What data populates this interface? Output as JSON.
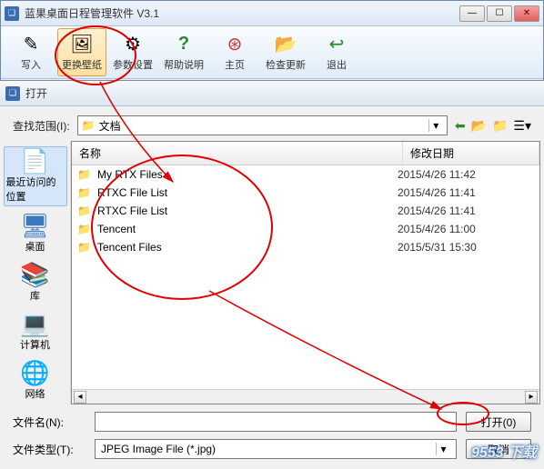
{
  "app": {
    "title": "蓝果桌面日程管理软件 V3.1",
    "toolbar": [
      {
        "label": "写入",
        "icon": "✎"
      },
      {
        "label": "更换壁纸",
        "icon": "🖼",
        "active": true
      },
      {
        "label": "参数设置",
        "icon": "⚙"
      },
      {
        "label": "帮助说明",
        "icon": "?"
      },
      {
        "label": "主页",
        "icon": "⊛"
      },
      {
        "label": "检查更新",
        "icon": "📂"
      },
      {
        "label": "退出",
        "icon": "↩"
      }
    ]
  },
  "dialog": {
    "title": "打开",
    "lookin_label": "查找范围(I):",
    "lookin_value": "文档",
    "nav_icons": [
      "arrow-left",
      "up-folder",
      "new-folder",
      "views"
    ],
    "places": [
      {
        "label": "最近访问的位置",
        "icon": "📄",
        "selected": true
      },
      {
        "label": "桌面",
        "icon": "🖥"
      },
      {
        "label": "库",
        "icon": "📚"
      },
      {
        "label": "计算机",
        "icon": "💻"
      },
      {
        "label": "网络",
        "icon": "🌐"
      }
    ],
    "columns": {
      "name": "名称",
      "date": "修改日期"
    },
    "files": [
      {
        "name": "My RTX Files",
        "date": "2015/4/26 11:42"
      },
      {
        "name": "RTXC File List",
        "date": "2015/4/26 11:41"
      },
      {
        "name": "RTXC File List",
        "date": "2015/4/26 11:41"
      },
      {
        "name": "Tencent",
        "date": "2015/4/26 11:00"
      },
      {
        "name": "Tencent Files",
        "date": "2015/5/31 15:30"
      }
    ],
    "filename_label": "文件名(N):",
    "filename_value": "",
    "filetype_label": "文件类型(T):",
    "filetype_value": "JPEG Image File (*.jpg)",
    "open_btn": "打开(0)",
    "cancel_btn": "取消"
  },
  "watermark": "9553 下载"
}
